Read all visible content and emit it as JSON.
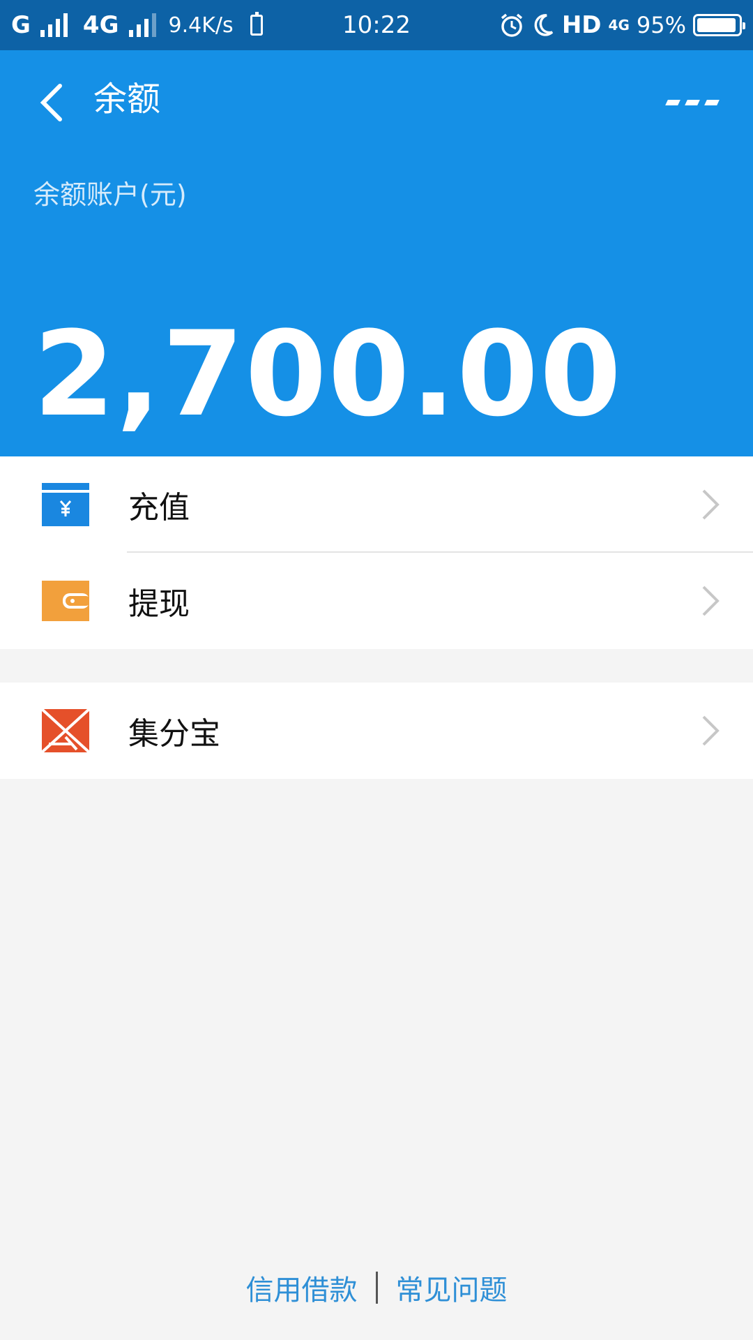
{
  "status_bar": {
    "carrier1": "G",
    "carrier2": "4G",
    "speed": "9.4K/s",
    "time": "10:22",
    "hd": "HD",
    "net": "4G",
    "battery": "95%",
    "battery_level": 0.95
  },
  "header": {
    "title": "余额",
    "account_label": "余额账户(元)",
    "balance": "2,700.00"
  },
  "menu": {
    "items": [
      {
        "label": "充值",
        "icon": "recharge-yuan-icon",
        "color": "#1a87e0"
      },
      {
        "label": "提现",
        "icon": "wallet-icon",
        "color": "#f2a03c"
      },
      {
        "label": "集分宝",
        "icon": "jifenbao-icon",
        "color": "#e5502a"
      }
    ]
  },
  "footer": {
    "link1": "信用借款",
    "link2": "常见问题"
  },
  "colors": {
    "status_bar": "#0d62a6",
    "header": "#1590e6",
    "background": "#f4f4f4",
    "link": "#2e8fd6"
  }
}
